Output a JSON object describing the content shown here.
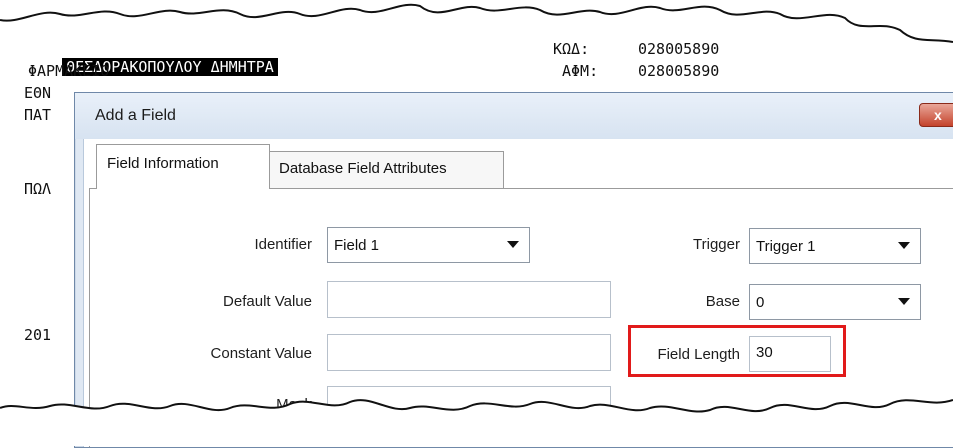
{
  "background_doc": {
    "lines": [
      "ΘΕΣΔΟΡΑΚΟΠΟΥΛΟΥ ΔΗΜΗΤΡΑ",
      "ΦΑΡΜΑΚΕΙΟ",
      "ΕΘΝ",
      "ΠΑΤ",
      "ΠΩΛ",
      "201"
    ],
    "kod_label": "ΚΩΔ:",
    "kod_value": "028005890",
    "afm_label": "ΑΦΜ:",
    "afm_value": "028005890"
  },
  "dialog": {
    "title": "Add a Field",
    "close_label": "x",
    "tabs": [
      {
        "label": "Field Information",
        "active": true
      },
      {
        "label": "Database Field Attributes",
        "active": false
      }
    ],
    "fields": {
      "identifier_label": "Identifier",
      "identifier_value": "Field 1",
      "default_value_label": "Default Value",
      "default_value": "",
      "constant_value_label": "Constant Value",
      "constant_value": "",
      "mask_label": "Mask",
      "mask_value": "",
      "trigger_label": "Trigger",
      "trigger_value": "Trigger 1",
      "base_label": "Base",
      "base_value": "0",
      "field_length_label": "Field Length",
      "field_length_value": "30"
    }
  },
  "colors": {
    "highlight_box": "#e11a1a",
    "titlebar": "#dfe8f3",
    "close_button": "#c4432c"
  }
}
